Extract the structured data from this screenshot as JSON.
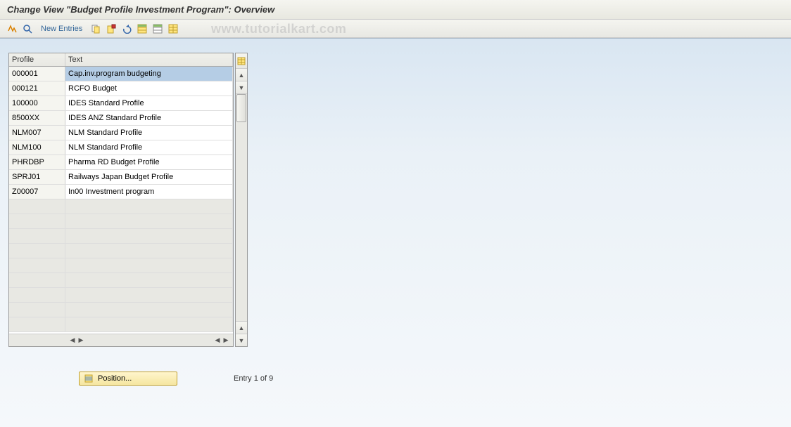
{
  "title": "Change View \"Budget Profile Investment Program\": Overview",
  "toolbar": {
    "new_entries_label": "New Entries"
  },
  "watermark": "www.tutorialkart.com",
  "table": {
    "headers": {
      "profile": "Profile",
      "text": "Text"
    },
    "rows": [
      {
        "profile": "000001",
        "text": "Cap.inv.program budgeting",
        "selected": true
      },
      {
        "profile": "000121",
        "text": "RCFO Budget",
        "selected": false
      },
      {
        "profile": "100000",
        "text": "IDES Standard Profile",
        "selected": false
      },
      {
        "profile": "8500XX",
        "text": "IDES ANZ Standard Profile",
        "selected": false
      },
      {
        "profile": "NLM007",
        "text": "NLM Standard Profile",
        "selected": false
      },
      {
        "profile": "NLM100",
        "text": "NLM Standard Profile",
        "selected": false
      },
      {
        "profile": "PHRDBP",
        "text": "Pharma RD Budget Profile",
        "selected": false
      },
      {
        "profile": "SPRJ01",
        "text": "Railways Japan Budget Profile",
        "selected": false
      },
      {
        "profile": "Z00007",
        "text": "In00 Investment program",
        "selected": false
      }
    ],
    "empty_rows": 9
  },
  "footer": {
    "position_label": "Position...",
    "entry_status": "Entry 1 of 9"
  }
}
